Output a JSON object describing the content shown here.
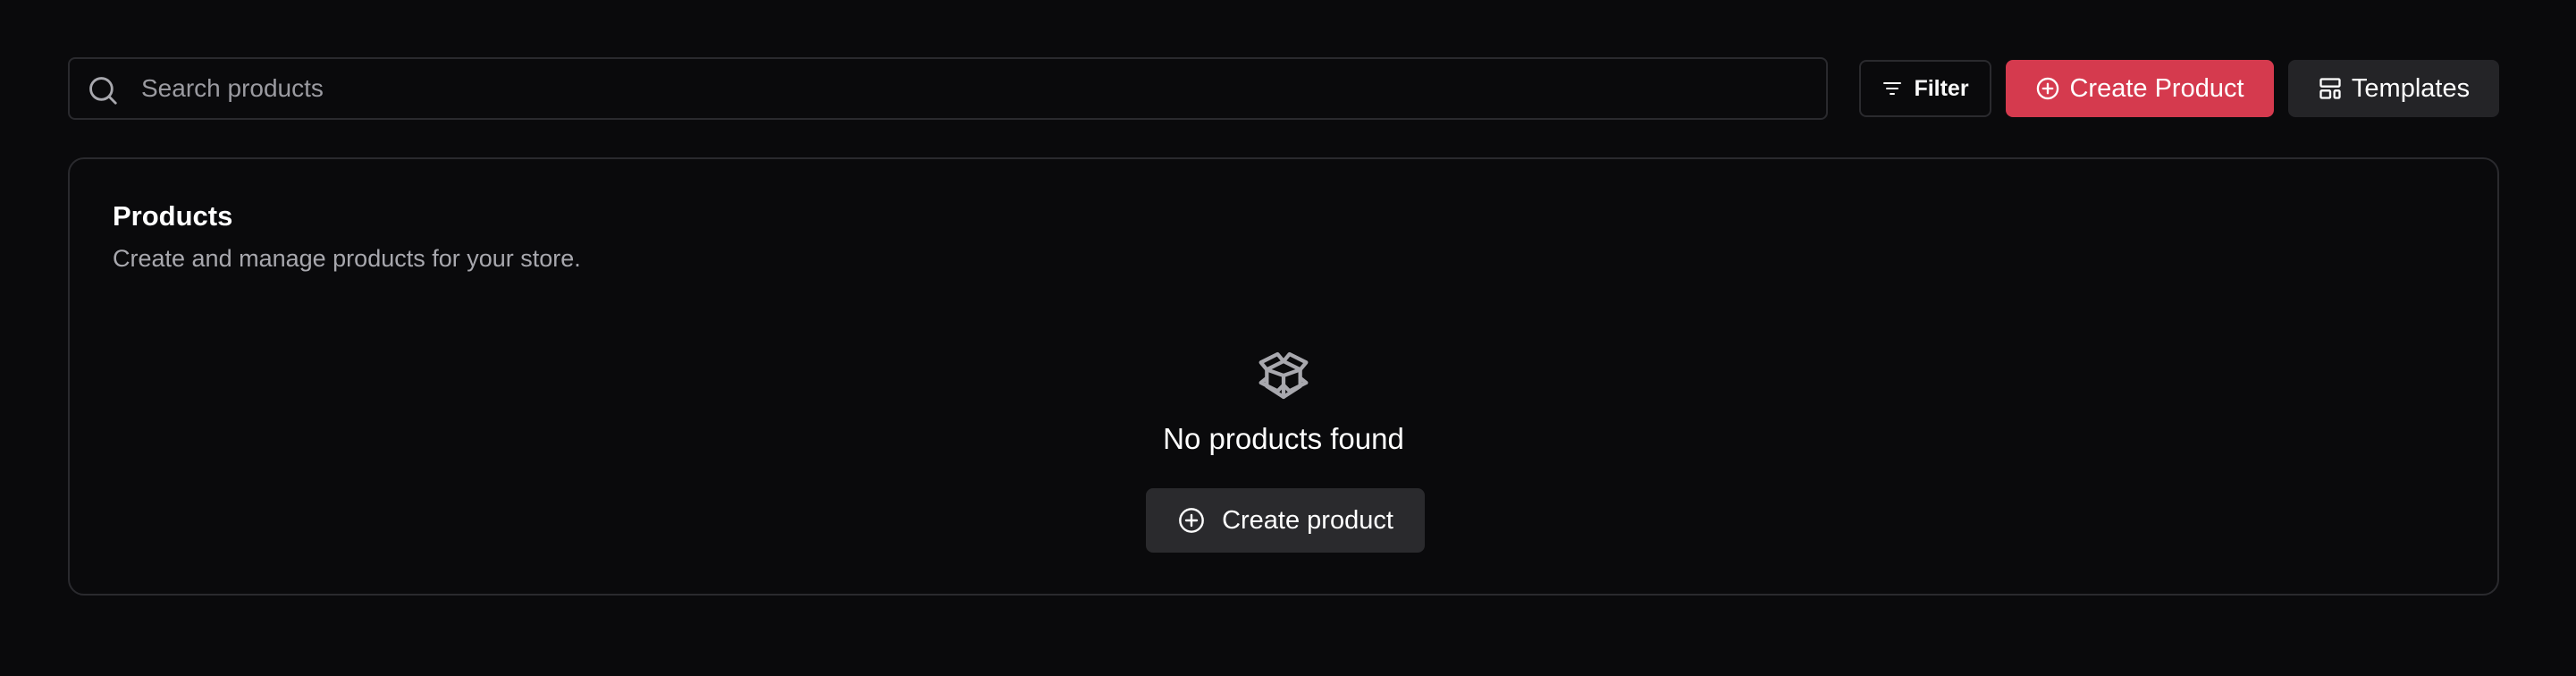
{
  "search": {
    "placeholder": "Search products",
    "icon": "search-icon"
  },
  "toolbar": {
    "filter_label": "Filter",
    "filter_icon": "filter-icon",
    "create_label": "Create Product",
    "create_icon": "plus-circle-icon",
    "templates_label": "Templates",
    "templates_icon": "layout-template-icon"
  },
  "card": {
    "title": "Products",
    "description": "Create and manage products for your store.",
    "empty_icon": "package-open-icon",
    "empty_title": "No products found",
    "empty_button_label": "Create product",
    "empty_button_icon": "plus-circle-icon"
  },
  "colors": {
    "background": "#0a0a0c",
    "accent": "#d53a4e",
    "border": "#2a2a2e",
    "secondary_button": "#242427",
    "muted_text": "#a8a8ae"
  }
}
